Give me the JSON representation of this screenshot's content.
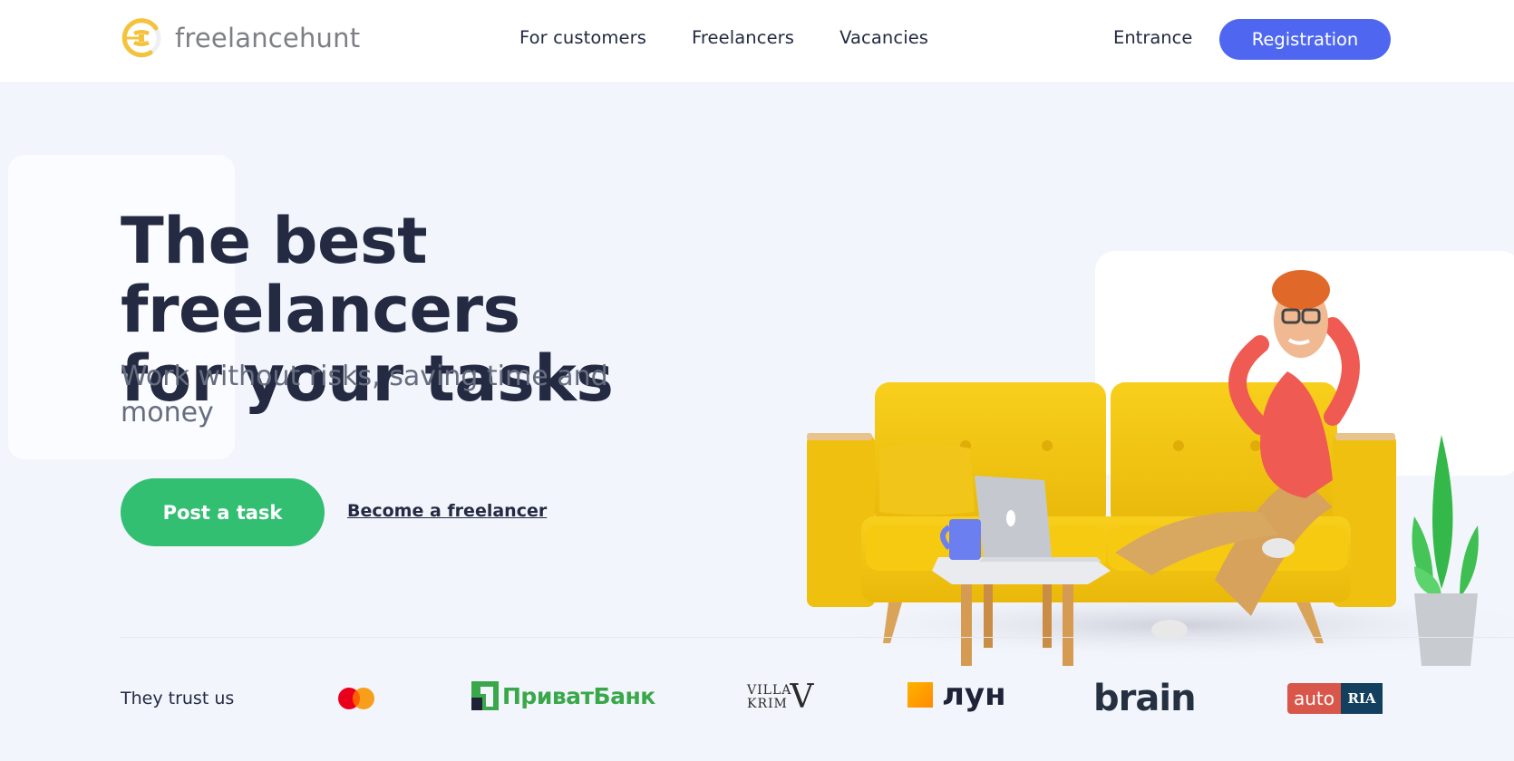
{
  "header": {
    "logo_text": "freelancehunt",
    "nav": [
      {
        "label": "For customers"
      },
      {
        "label": "Freelancers"
      },
      {
        "label": "Vacancies"
      }
    ],
    "entrance_label": "Entrance",
    "registration_label": "Registration"
  },
  "hero": {
    "title_line1": "The best freelancers",
    "title_line2": "for your tasks",
    "subtitle": "Work without risks, saving time and money",
    "post_task_label": "Post a task",
    "become_freelancer_label": "Become a freelancer"
  },
  "trust": {
    "label": "They trust us",
    "brands": {
      "mastercard": "mastercard-logo",
      "privatbank": "ПриватБанк",
      "villa_line1": "VILLA",
      "villa_line2": "KRIM",
      "villa_v": "V",
      "lun": "лун",
      "brain": "brain",
      "auto": "auto",
      "ria": "RIA"
    }
  },
  "colors": {
    "brand_yellow": "#f5c33b",
    "registration_blue": "#4f67f0",
    "post_green": "#33bf72",
    "text_dark": "#232a42",
    "background": "#f3f5fc"
  }
}
